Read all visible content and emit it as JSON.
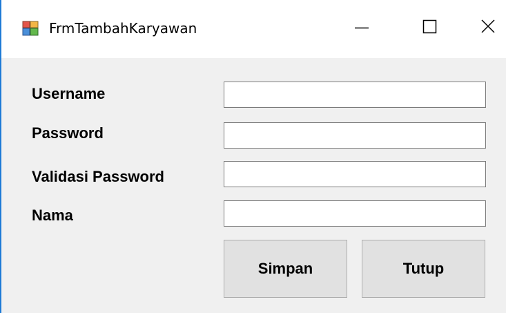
{
  "window": {
    "title": "FrmTambahKaryawan",
    "icon": "winforms-app-icon",
    "controls": {
      "minimize_icon": "minimize-icon",
      "maximize_icon": "maximize-icon",
      "close_icon": "close-icon"
    }
  },
  "form": {
    "fields": [
      {
        "label": "Username",
        "value": ""
      },
      {
        "label": "Password",
        "value": ""
      },
      {
        "label": "Validasi Password",
        "value": ""
      },
      {
        "label": "Nama",
        "value": ""
      }
    ],
    "buttons": {
      "save_label": "Simpan",
      "close_label": "Tutup"
    }
  },
  "colors": {
    "form_background": "#f0f0f0",
    "titlebar_background": "#ffffff",
    "button_face": "#e1e1e1",
    "window_accent_border": "#1e7ad6"
  }
}
